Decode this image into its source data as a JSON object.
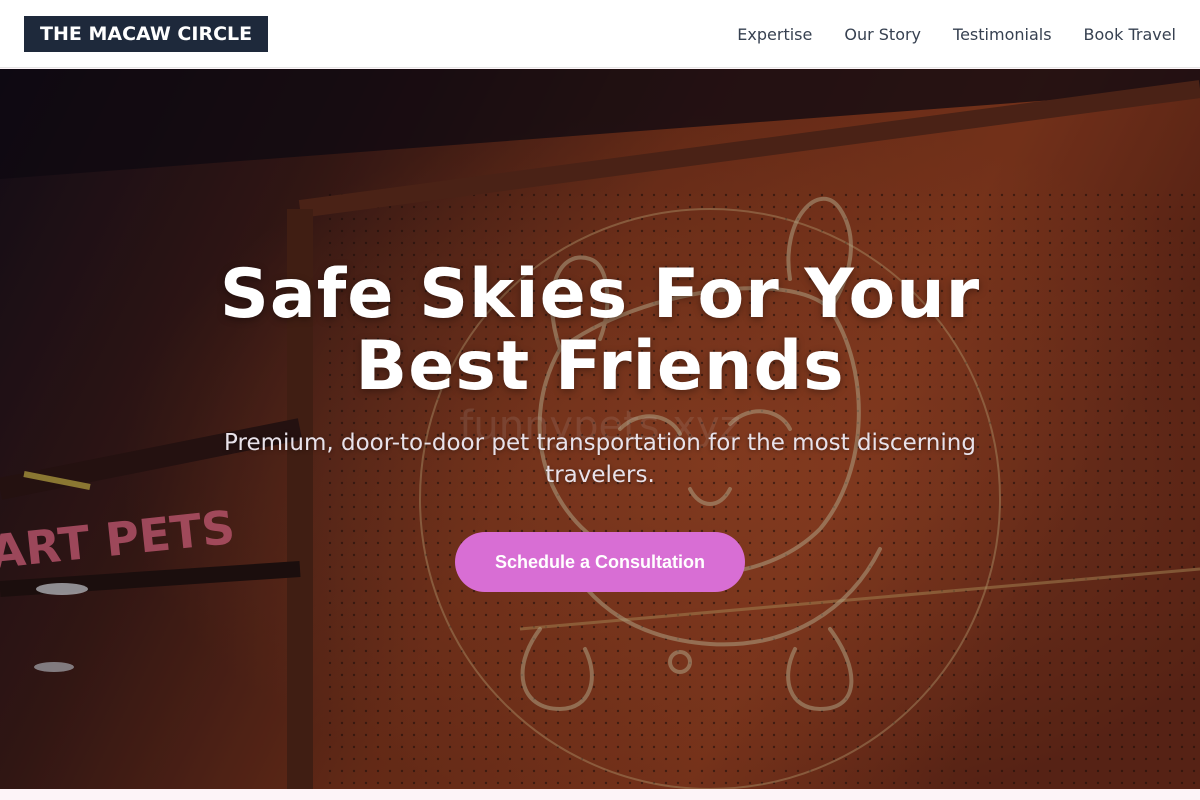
{
  "header": {
    "logo": "THE MACAW CIRCLE",
    "nav": [
      "Expertise",
      "Our Story",
      "Testimonials",
      "Book Travel"
    ]
  },
  "hero": {
    "title_line1": "Safe Skies For Your",
    "title_line2": "Best Friends",
    "subtitle": "Premium, door-to-door pet transportation for the most discerning travelers.",
    "cta": "Schedule a Consultation",
    "background_sign_text": "ART PETS",
    "watermark": "funnypets.xyz"
  },
  "colors": {
    "logo_bg": "#1e293b",
    "cta": "#d86ed4",
    "nav_text": "#374151"
  }
}
